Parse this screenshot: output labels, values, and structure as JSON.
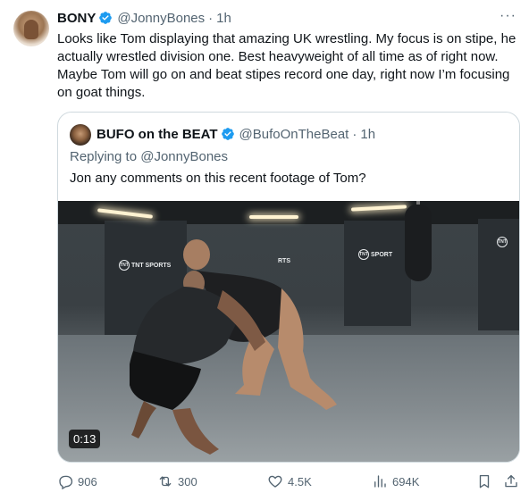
{
  "tweet": {
    "author_name": "BONY",
    "author_handle": "@JonnyBones",
    "separator": "·",
    "time": "1h",
    "more_label": "···",
    "text": "Looks like Tom displaying that amazing UK wrestling. My focus is on stipe, he actually wrestled division one. Best heavyweight of all time as of right now. Maybe Tom will go on and beat stipes record one day, right now I’m focusing on goat things."
  },
  "quote": {
    "author_name": "BUFO on the BEAT",
    "author_handle": "@BufoOnTheBeat",
    "separator": "·",
    "time": "1h",
    "replying_prefix": "Replying to ",
    "replying_to": "@JonnyBones",
    "text": "Jon any comments on this recent footage of Tom?",
    "video": {
      "duration": "0:13",
      "logos": [
        "TNT SPORTS",
        "RTS",
        "SPORT",
        "TNT"
      ]
    }
  },
  "actions": {
    "replies": "906",
    "reposts": "300",
    "likes": "4.5K",
    "views": "694K"
  },
  "colors": {
    "verified": "#1d9bf0",
    "secondary_text": "#536471",
    "primary_text": "#0f1419",
    "border": "#cfd9de"
  },
  "icons": [
    "verified-badge-icon",
    "more-icon",
    "reply-icon",
    "repost-icon",
    "like-icon",
    "views-icon",
    "bookmark-icon",
    "share-icon"
  ]
}
